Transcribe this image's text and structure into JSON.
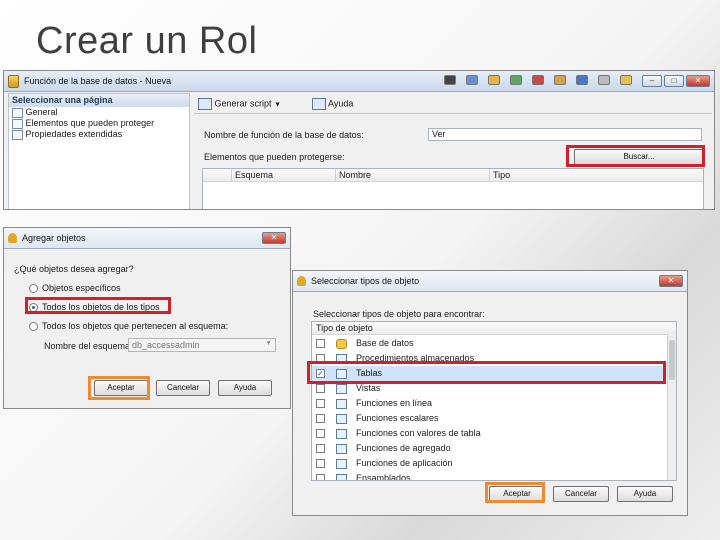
{
  "slide": {
    "title": "Crear un Rol"
  },
  "main_window": {
    "title": "Función de la base de datos - Nueva",
    "sidebar_header": "Seleccionar una página",
    "sidebar_items": [
      "General",
      "Elementos que pueden proteger",
      "Propiedades extendidas"
    ],
    "toolbar": {
      "script_label": "Generar script",
      "help_label": "Ayuda"
    },
    "role_name_label": "Nombre de función de la base de datos:",
    "role_name_value": "Ver",
    "securables_label": "Elementos que pueden protegerse:",
    "search_button": "Buscar...",
    "grid_columns": [
      "Esquema",
      "Nombre",
      "Tipo"
    ]
  },
  "add_objects_dialog": {
    "title": "Agregar objetos",
    "question": "¿Qué objetos desea agregar?",
    "options": [
      "Objetos específicos",
      "Todos los objetos de los tipos",
      "Todos los objetos que pertenecen al esquema:"
    ],
    "selected_option": 1,
    "schema_label": "Nombre del esquema:",
    "schema_value": "db_accessadmin",
    "buttons": {
      "ok": "Aceptar",
      "cancel": "Cancelar",
      "help": "Ayuda"
    }
  },
  "select_types_dialog": {
    "title": "Seleccionar tipos de objeto",
    "prompt": "Seleccionar tipos de objeto para encontrar:",
    "column_header": "Tipo de objeto",
    "items": [
      {
        "label": "Base de datos",
        "checked": false,
        "icon": "database-icon"
      },
      {
        "label": "Procedimientos almacenados",
        "checked": false,
        "icon": "stored-procedure-icon"
      },
      {
        "label": "Tablas",
        "checked": true,
        "icon": "table-icon"
      },
      {
        "label": "Vistas",
        "checked": false,
        "icon": "view-icon"
      },
      {
        "label": "Funciones en línea",
        "checked": false,
        "icon": "function-icon"
      },
      {
        "label": "Funciones escalares",
        "checked": false,
        "icon": "function-icon"
      },
      {
        "label": "Funciones con valores de tabla",
        "checked": false,
        "icon": "function-icon"
      },
      {
        "label": "Funciones de agregado",
        "checked": false,
        "icon": "function-icon"
      },
      {
        "label": "Funciones de aplicación",
        "checked": false,
        "icon": "function-icon"
      },
      {
        "label": "Ensamblados",
        "checked": false,
        "icon": "assembly-icon"
      }
    ],
    "buttons": {
      "ok": "Aceptar",
      "cancel": "Cancelar",
      "help": "Ayuda"
    }
  },
  "colors": {
    "highlight_red": "#d2202a",
    "highlight_orange": "#f0892f",
    "selection_blue": "#cfe3fb"
  }
}
